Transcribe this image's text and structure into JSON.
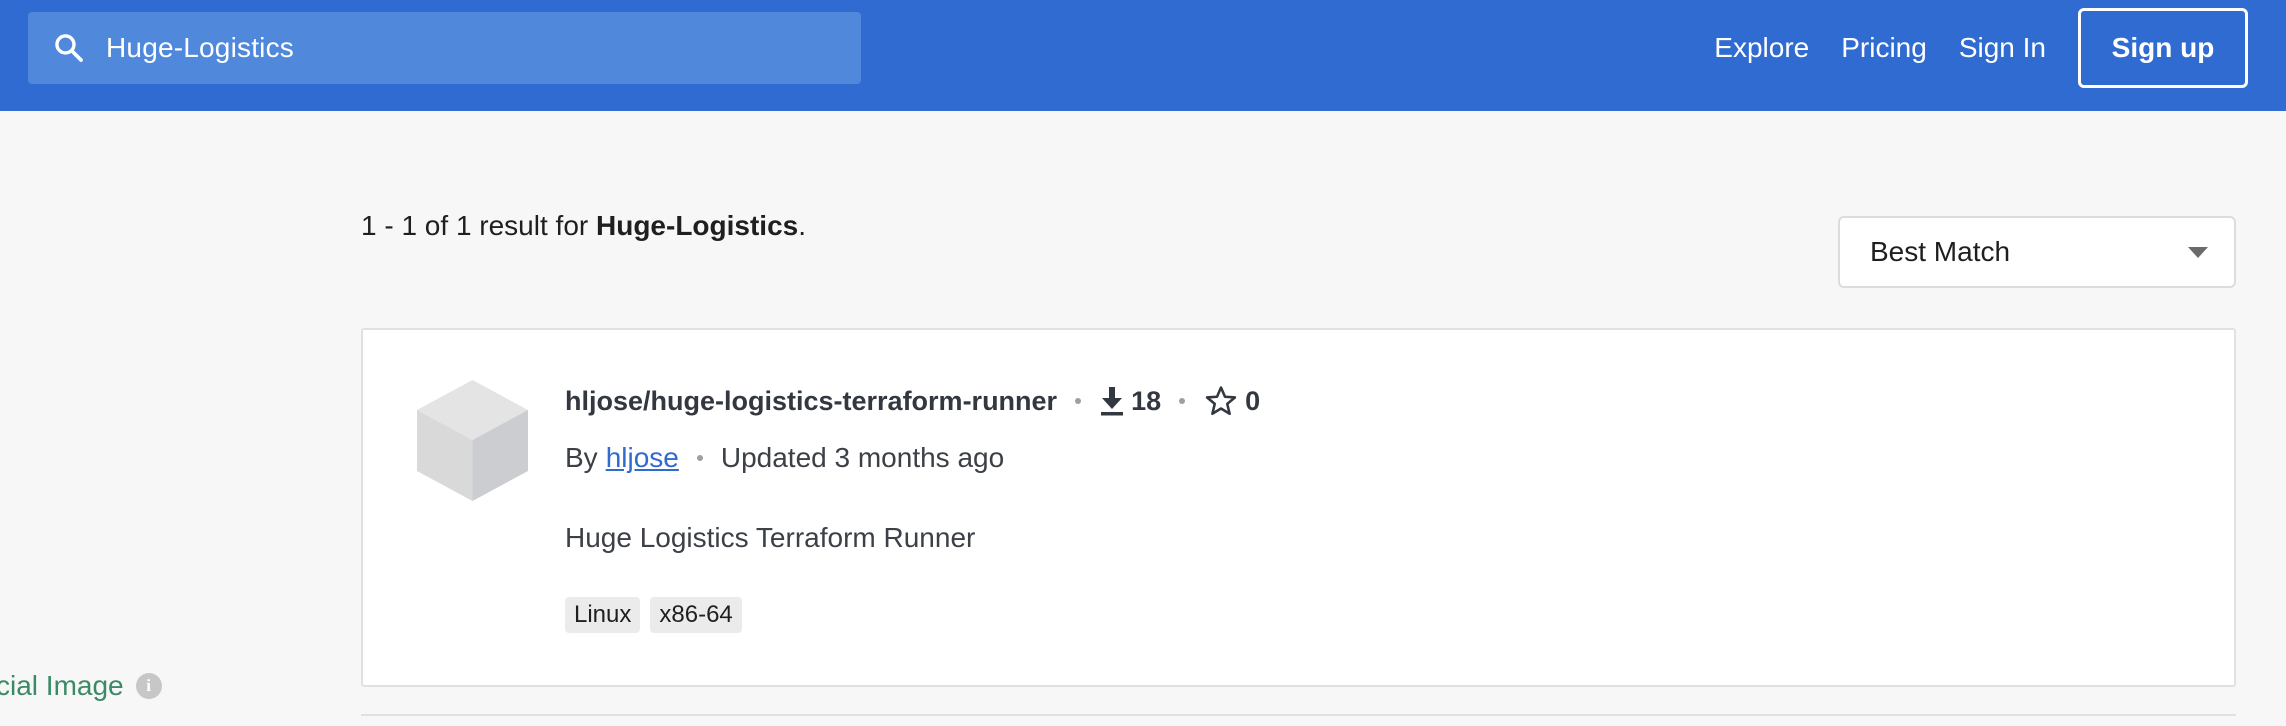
{
  "header": {
    "search": {
      "value": "Huge-Logistics",
      "icon": "search-icon"
    },
    "nav": {
      "explore": "Explore",
      "pricing": "Pricing",
      "sign_in": "Sign In",
      "sign_up": "Sign up"
    },
    "colors": {
      "bar": "#2f6bd0",
      "search_bg": "#5089dc"
    }
  },
  "results": {
    "summary_prefix": "1 - 1 of 1 result for ",
    "summary_query": "Huge-Logistics",
    "summary_suffix": ".",
    "sort": {
      "selected": "Best Match"
    }
  },
  "items": [
    {
      "repo": "hljose/huge-logistics-terraform-runner",
      "downloads": "18",
      "stars": "0",
      "by_label": "By",
      "author": "hljose",
      "updated": "Updated 3 months ago",
      "description": "Huge Logistics Terraform Runner",
      "tags": [
        "Linux",
        "x86-64"
      ]
    }
  ],
  "sidebar": {
    "partial_filter": "cial Image",
    "info_glyph": "i"
  }
}
